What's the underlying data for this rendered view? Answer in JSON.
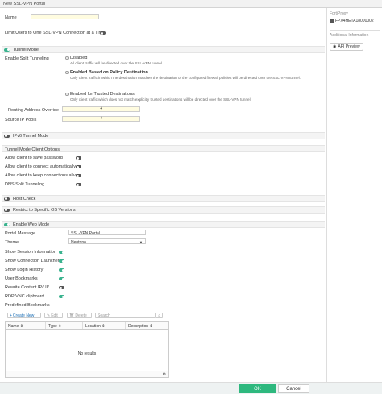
{
  "window": {
    "title": "New SSL-VPN Portal"
  },
  "form": {
    "name_label": "Name",
    "name_value": "",
    "limit_label": "Limit Users to One SSL-VPN Connection at a Time"
  },
  "tunnel": {
    "section_label": "Tunnel Mode",
    "split_label": "Enable Split Tunneling",
    "options": [
      {
        "label": "Disabled",
        "desc": "All client traffic will be directed over the SSL-VPN tunnel."
      },
      {
        "label": "Enabled Based on Policy Destination",
        "desc": "Only client traffic in which the destination matches the destination of the configured firewall policies will be directed over the SSL-VPN tunnel."
      },
      {
        "label": "Enabled for Trusted Destinations",
        "desc": "Only client traffic which does not match explicitly trusted destinations will be directed over the SSL-VPN tunnel."
      }
    ],
    "routing_label": "Routing Address Override",
    "pool_label": "Source IP Pools",
    "add_symbol": "+"
  },
  "ipv6": {
    "section_label": "IPv6 Tunnel Mode"
  },
  "client_opts": {
    "header": "Tunnel Mode Client Options",
    "items": [
      "Allow client to save password",
      "Allow client to connect automatically",
      "Allow client to keep connections alive",
      "DNS Split Tunneling"
    ]
  },
  "host_check": {
    "label": "Host Check"
  },
  "restrict_os": {
    "label": "Restrict to Specific OS Versions"
  },
  "web": {
    "section_label": "Enable Web Mode",
    "portal_msg_label": "Portal Message",
    "portal_msg_value": "SSL-VPN Portal",
    "theme_label": "Theme",
    "theme_value": "Neutrino",
    "toggles": [
      {
        "label": "Show Session Information",
        "on": true
      },
      {
        "label": "Show Connection Launcher",
        "on": true
      },
      {
        "label": "Show Login History",
        "on": true
      },
      {
        "label": "User Bookmarks",
        "on": true
      },
      {
        "label": "Rewrite Content IP/UI/",
        "on": false
      },
      {
        "label": "RDP/VNC clipboard",
        "on": true
      }
    ],
    "bookmarks_label": "Predefined Bookmarks"
  },
  "bookmarks": {
    "create_label": "Create New",
    "edit_label": "Edit",
    "delete_label": "Delete",
    "search_placeholder": "Search",
    "columns": [
      "Name",
      "Type",
      "Location",
      "Description"
    ],
    "empty_text": "No results"
  },
  "sidebar": {
    "device_label": "FortiProxy",
    "device_name": "FPX4HETA18000002",
    "info_label": "Additional Information",
    "api_label": "API Preview"
  },
  "footer": {
    "ok_label": "OK",
    "cancel_label": "Cancel"
  },
  "colors": {
    "accent": "#2eb87e",
    "toggle_on": "#3bb38f",
    "highlight_input": "#fffce0"
  }
}
